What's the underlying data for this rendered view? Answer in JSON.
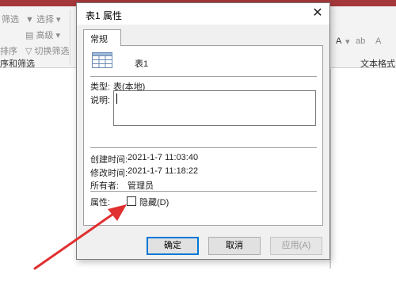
{
  "app": {
    "title_partial": "...",
    "ribbon": {
      "filter_label": "筛选",
      "selection_label": "选择",
      "advanced_label": "高级",
      "remove_sort_label": "排序",
      "toggle_filter_label": "切换筛选",
      "group_sort_filter": "序和筛选",
      "group_text_format": "文本格式",
      "font_color_glyph": "A",
      "highlight_glyph": "ab",
      "fill_glyph": "A"
    }
  },
  "dialog": {
    "title": "表1 属性",
    "tab_label": "常规",
    "object_name": "表1",
    "type_label": "类型:",
    "type_value": "表(本地)",
    "description_label": "说明:",
    "created_label": "创建时间:",
    "created_value": "2021-1-7 11:03:40",
    "modified_label": "修改时间:",
    "modified_value": "2021-1-7 11:18:22",
    "owner_label": "所有者:",
    "owner_value": "管理员",
    "attributes_label": "属性:",
    "hidden_label": "隐藏(D)",
    "hidden_checked": false,
    "ok_label": "确定",
    "cancel_label": "取消",
    "apply_label": "应用(A)"
  },
  "colors": {
    "titlebar": "#a4373a",
    "focus_border": "#0078d7",
    "annotation_arrow": "#e03030"
  }
}
